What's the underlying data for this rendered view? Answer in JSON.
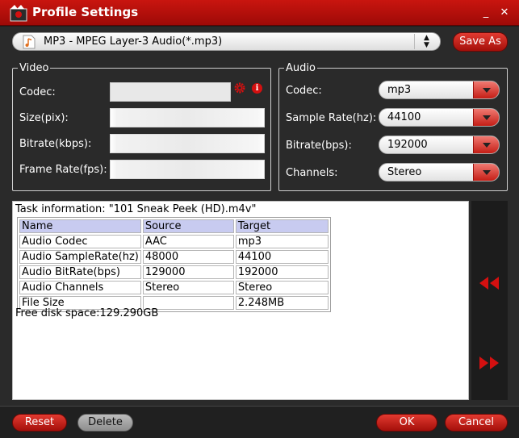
{
  "window": {
    "title": "Profile Settings",
    "minimize": "_",
    "close": "✕"
  },
  "profile": {
    "selected": "MP3 - MPEG Layer-3 Audio(*.mp3)",
    "save_as_label": "Save As"
  },
  "video": {
    "legend": "Video",
    "codec_label": "Codec:",
    "size_label": "Size(pix):",
    "bitrate_label": "Bitrate(kbps):",
    "framerate_label": "Frame Rate(fps):"
  },
  "audio": {
    "legend": "Audio",
    "codec_label": "Codec:",
    "codec_value": "mp3",
    "samplerate_label": "Sample Rate(hz):",
    "samplerate_value": "44100",
    "bitrate_label": "Bitrate(bps):",
    "bitrate_value": "192000",
    "channels_label": "Channels:",
    "channels_value": "Stereo"
  },
  "task": {
    "title": "Task information: \"101 Sneak Peek (HD).m4v\"",
    "headers": [
      "Name",
      "Source",
      "Target"
    ],
    "rows": [
      [
        "Audio Codec",
        "AAC",
        "mp3"
      ],
      [
        "Audio SampleRate(hz)",
        "48000",
        "44100"
      ],
      [
        "Audio BitRate(bps)",
        "129000",
        "192000"
      ],
      [
        "Audio Channels",
        "Stereo",
        "Stereo"
      ],
      [
        "File Size",
        "",
        "2.248MB"
      ]
    ],
    "free_disk": "Free disk space:129.290GB"
  },
  "buttons": {
    "reset": "Reset",
    "delete": "Delete",
    "ok": "OK",
    "cancel": "Cancel"
  },
  "colors": {
    "accent": "#c0130d",
    "header_cell": "#c8cbf0"
  }
}
